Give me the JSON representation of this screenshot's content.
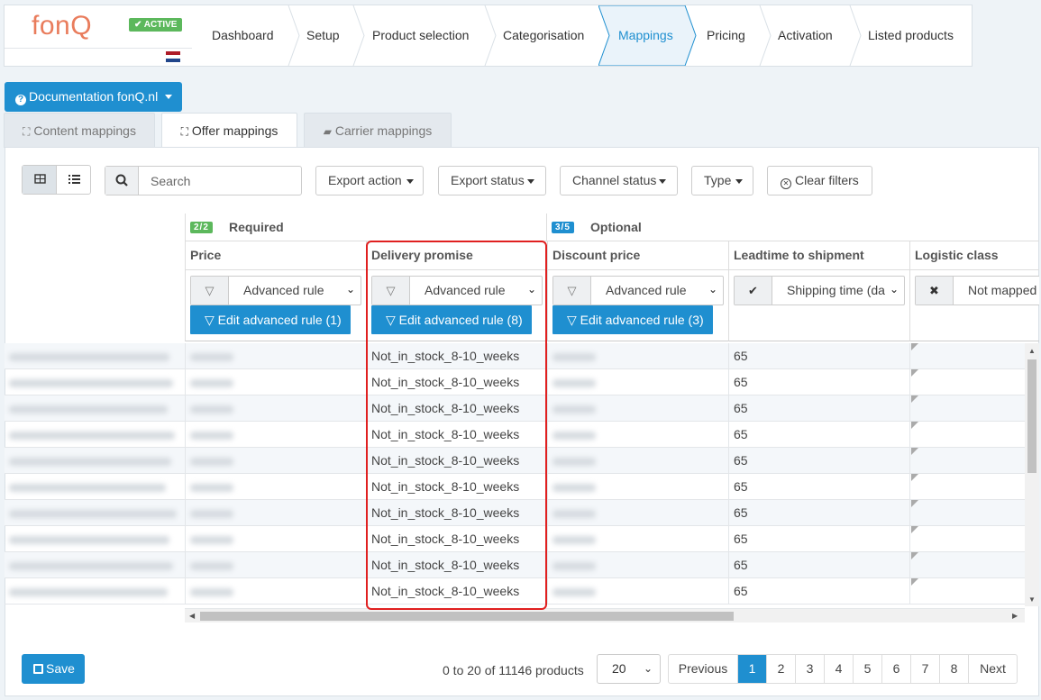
{
  "brand": {
    "logo": "fonQ",
    "status_badge": "✔ ACTIVE"
  },
  "steps": [
    {
      "label": "Dashboard",
      "active": false
    },
    {
      "label": "Setup",
      "active": false
    },
    {
      "label": "Product selection",
      "active": false
    },
    {
      "label": "Categorisation",
      "active": false
    },
    {
      "label": "Mappings",
      "active": true
    },
    {
      "label": "Pricing",
      "active": false
    },
    {
      "label": "Activation",
      "active": false
    },
    {
      "label": "Listed products",
      "active": false
    }
  ],
  "doc_button": "Documentation fonQ.nl",
  "tabs": [
    {
      "label": "Content mappings",
      "icon": "map-icon",
      "active": false
    },
    {
      "label": "Offer mappings",
      "icon": "map-icon",
      "active": true
    },
    {
      "label": "Carrier mappings",
      "icon": "truck-icon",
      "active": false
    }
  ],
  "toolbar": {
    "search_placeholder": "Search",
    "export_action": "Export action",
    "export_status": "Export status",
    "channel_status": "Channel status",
    "type": "Type",
    "clear_filters": "Clear filters"
  },
  "groups": {
    "required": {
      "badge": "2/2",
      "title": "Required",
      "color": "#5cb85c"
    },
    "optional": {
      "badge": "3/5",
      "title": "Optional",
      "color": "#1f8fd0"
    }
  },
  "columns": [
    {
      "title": "Price",
      "select": "Advanced rule",
      "icon": "filter-icon",
      "edit": "Edit advanced rule (1)"
    },
    {
      "title": "Delivery promise",
      "select": "Advanced rule",
      "icon": "filter-icon",
      "edit": "Edit advanced rule (8)"
    },
    {
      "title": "Discount price",
      "select": "Advanced rule",
      "icon": "filter-icon",
      "edit": "Edit advanced rule (3)"
    },
    {
      "title": "Leadtime to shipment",
      "select": "Shipping time (da",
      "icon": "check-icon",
      "edit": ""
    },
    {
      "title": "Logistic class",
      "select": "Not mapped",
      "icon": "x-icon",
      "edit": ""
    }
  ],
  "rows": [
    {
      "delivery": "Not_in_stock_8-10_weeks",
      "leadtime": "65"
    },
    {
      "delivery": "Not_in_stock_8-10_weeks",
      "leadtime": "65"
    },
    {
      "delivery": "Not_in_stock_8-10_weeks",
      "leadtime": "65"
    },
    {
      "delivery": "Not_in_stock_8-10_weeks",
      "leadtime": "65"
    },
    {
      "delivery": "Not_in_stock_8-10_weeks",
      "leadtime": "65"
    },
    {
      "delivery": "Not_in_stock_8-10_weeks",
      "leadtime": "65"
    },
    {
      "delivery": "Not_in_stock_8-10_weeks",
      "leadtime": "65"
    },
    {
      "delivery": "Not_in_stock_8-10_weeks",
      "leadtime": "65"
    },
    {
      "delivery": "Not_in_stock_8-10_weeks",
      "leadtime": "65"
    },
    {
      "delivery": "Not_in_stock_8-10_weeks",
      "leadtime": "65"
    }
  ],
  "footer": {
    "save": "Save",
    "count": "0 to 20 of 11146 products",
    "per_page": "20",
    "pagination": [
      "Previous",
      "1",
      "2",
      "3",
      "4",
      "5",
      "6",
      "7",
      "8",
      "Next"
    ],
    "current_page": "1"
  },
  "colors": {
    "primary": "#1f8fd0",
    "logo": "#e97c5c",
    "highlight": "#e02020"
  }
}
